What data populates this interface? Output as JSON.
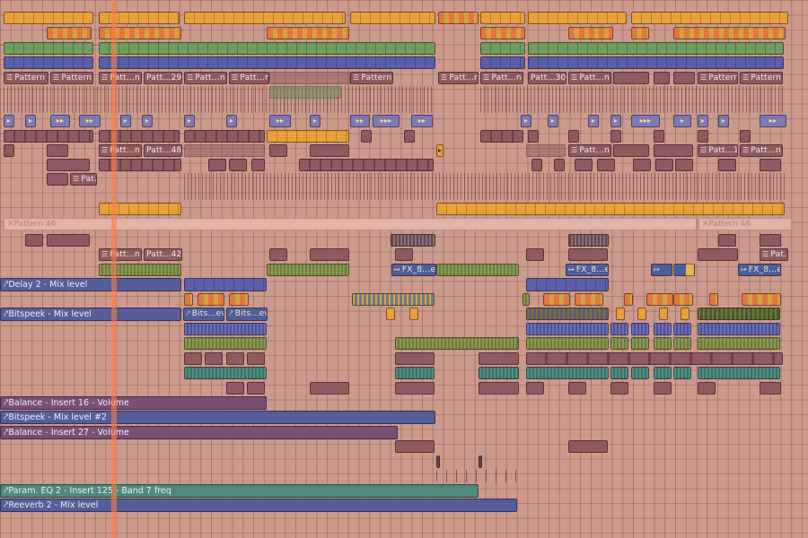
{
  "playlist": {
    "clips": {
      "pattern_1": "Pattern 1",
      "pattern_5": "Pattern 5",
      "patt_n_29": "Patt...n 29",
      "patt_29": "Patt...29",
      "patt_n_30": "Patt...n 30",
      "patt_n_34": "Patt...n 34",
      "pattern_3": "Pattern 3",
      "patt_n_69a": "Patt...n 69",
      "patt_n_69b": "Patt...n 69",
      "patt_30": "Patt...30",
      "patt_n_34b": "Patt...n 34",
      "pattern_1b": "Pattern 1",
      "pattern_5b": "Pattern 5",
      "patt_n_48": "Patt...n 48",
      "patt_48": "Patt...48",
      "patt_n_12": "Patt...n 12",
      "patt_13": "Patt...13",
      "patt_n_13": "Patt...n 13",
      "pat_6": "Pat...6",
      "pattern_46a": "Pattern 46",
      "pattern_46b": "Pattern 46",
      "patt_n_42": "Patt...n 42",
      "patt_42": "Patt...42",
      "pat_6b": "Pat...6",
      "fx_8_er2a": "FX_8...er2",
      "fx_8_er2b": "FX_8...er2",
      "fx_8_er2c": "FX_8...er2",
      "bits_evel_a": "Bits...evel",
      "bits_evel_b": "Bits...evel",
      "pattern_short_glyph": "☰"
    },
    "automation": {
      "delay2_mix": "Delay 2 - Mix level",
      "bitspeek_mix": "Bitspeek - Mix level",
      "balance_16": "Balance - Insert 16 - Volume",
      "bitspeek_mix2": "Bitspeek - Mix level #2",
      "balance_27": "Balance - Insert 27 - Volume",
      "param_eq": "Param. EQ 2 - Insert 125 - Band 7 freq",
      "reeverb_mix": "Reeverb 2 - Mix level"
    }
  }
}
